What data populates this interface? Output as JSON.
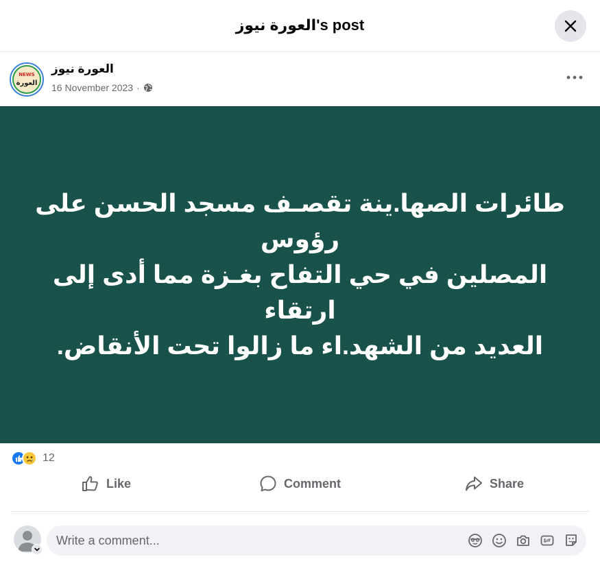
{
  "header": {
    "title": "العورة نيوز's post"
  },
  "post": {
    "author": "العورة نيوز",
    "date": "16 November 2023",
    "separator": "·",
    "avatar_badge_text": "NEWS",
    "avatar_text": "العورة",
    "image_lines": [
      "طائرات الصها.ينة تقصـف مسجد الحسن على رؤوس",
      "المصلين في حي التفاح بغـزة مما أدى إلى ارتقاء",
      "العديد من الشهد.اء ما زالوا تحت الأنقاض."
    ],
    "image_bg_color": "#19524a"
  },
  "reactions": {
    "count": "12",
    "types": [
      "like-icon",
      "sad-icon"
    ]
  },
  "actions": {
    "like": "Like",
    "comment": "Comment",
    "share": "Share"
  },
  "comment": {
    "placeholder": "Write a comment..."
  },
  "colors": {
    "accent": "#1877f2",
    "secondary_text": "#65676b",
    "divider": "#e4e6eb"
  }
}
